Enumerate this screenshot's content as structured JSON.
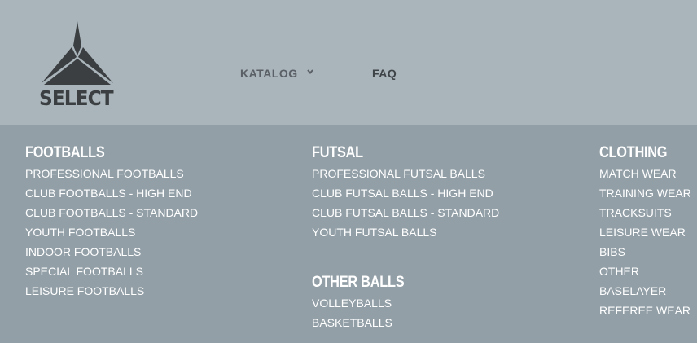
{
  "brand": {
    "logo_text": "SELECT"
  },
  "nav": {
    "katalog_label": "KATALOG",
    "faq_label": "FAQ"
  },
  "menu": {
    "columns": [
      {
        "heading": "FOOTBALLS",
        "items": [
          "PROFESSIONAL FOOTBALLS",
          "CLUB FOOTBALLS - HIGH END",
          "CLUB FOOTBALLS - STANDARD",
          "YOUTH FOOTBALLS",
          "INDOOR FOOTBALLS",
          "SPECIAL FOOTBALLS",
          "LEISURE FOOTBALLS"
        ]
      },
      {
        "heading": "FUTSAL",
        "items": [
          "PROFESSIONAL FUTSAL BALLS",
          "CLUB FUTSAL BALLS - HIGH END",
          "CLUB FUTSAL BALLS - STANDARD",
          "YOUTH FUTSAL BALLS"
        ]
      },
      {
        "heading": "OTHER BALLS",
        "items": [
          "VOLLEYBALLS",
          "BASKETBALLS"
        ]
      },
      {
        "heading": "CLOTHING",
        "items": [
          "MATCH WEAR",
          "TRAINING WEAR",
          "TRACKSUITS",
          "LEISURE WEAR",
          "BIBS",
          "OTHER",
          "BASELAYER",
          "REFEREE WEAR"
        ]
      }
    ]
  },
  "colors": {
    "header_bg": "#aab5bb",
    "menu_bg": "#929fa7",
    "logo": "#3b3f42",
    "menu_text": "#ffffff"
  },
  "icons": {
    "logo": "select-triangle-logo",
    "dropdown": "chevron-down-icon"
  }
}
